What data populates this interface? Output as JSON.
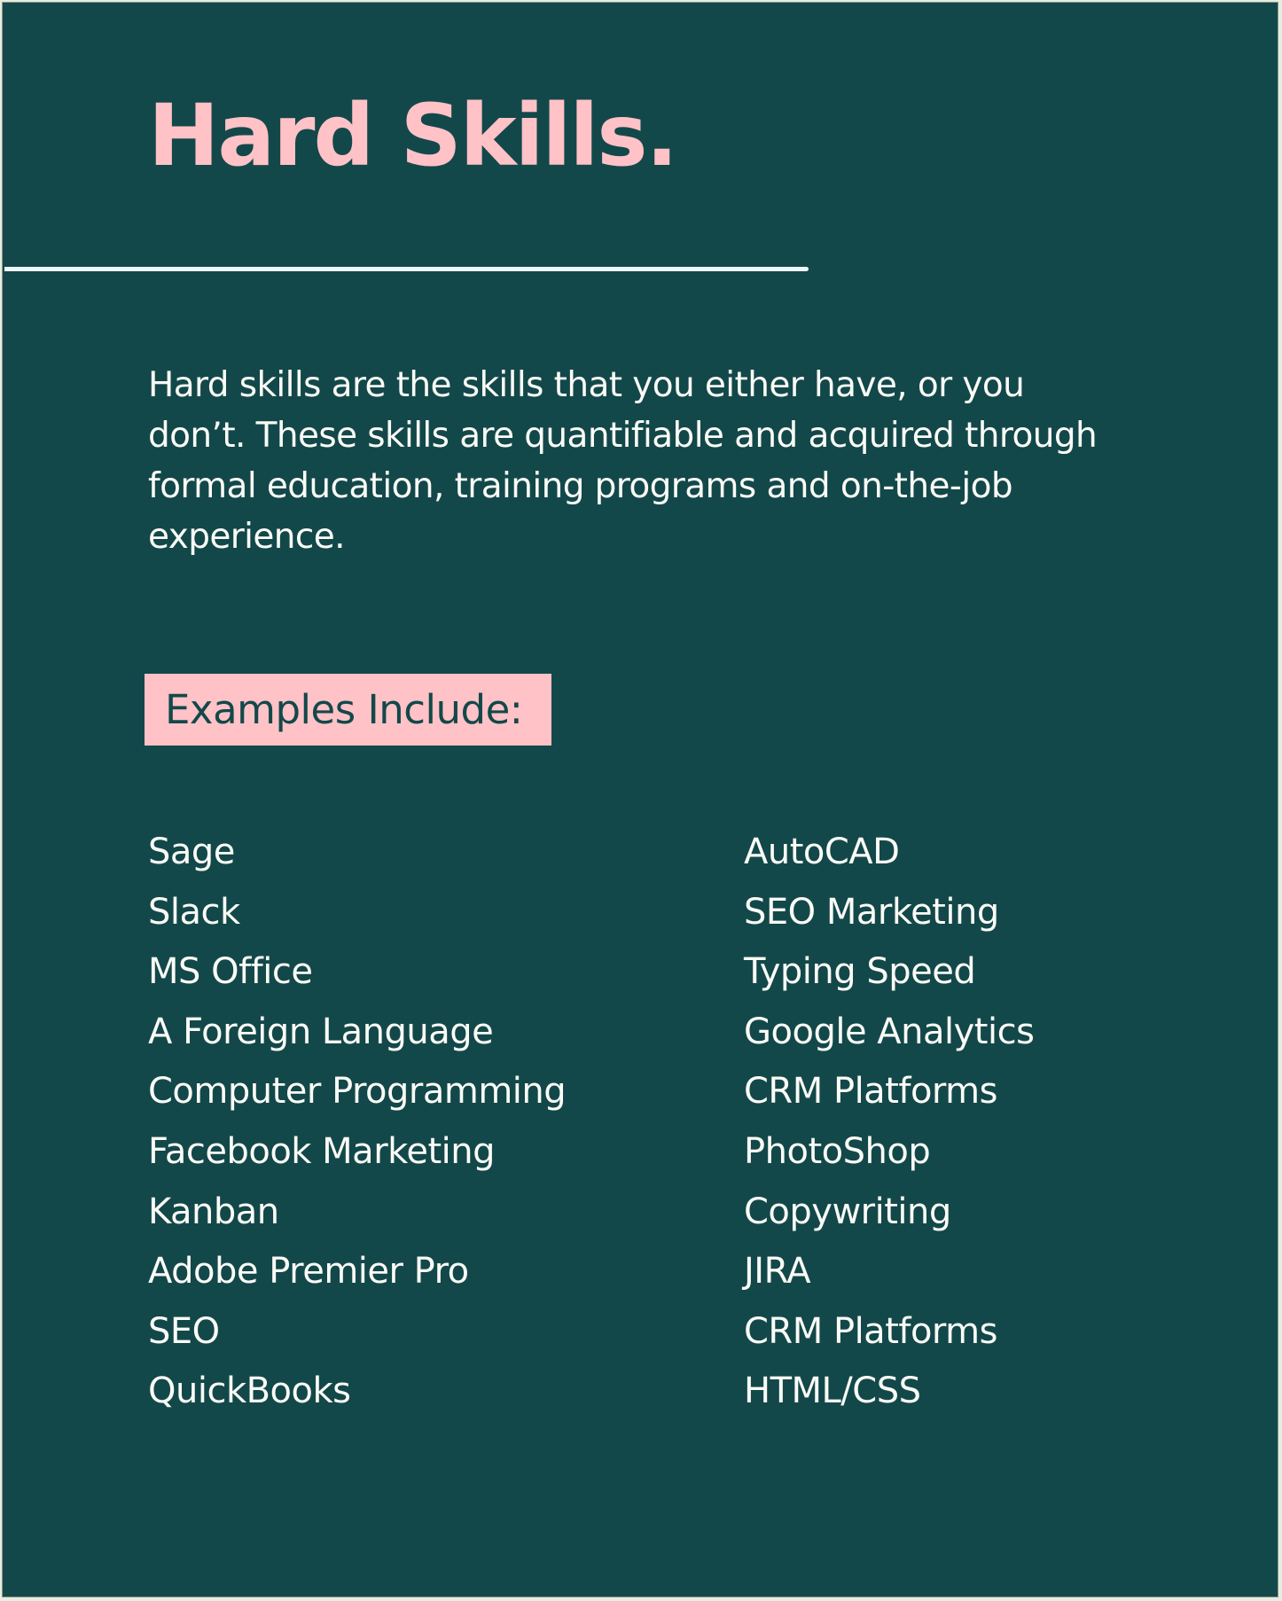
{
  "colors": {
    "background": "#13484a",
    "accent_pink": "#ffc2c7",
    "text_light": "#fbfbf6"
  },
  "title": "Hard Skills.",
  "intro": "Hard skills are the skills that you either have, or you don’t. These skills are quantifiable and acquired through formal education, training programs and on-the-job experience.",
  "examples_label": "Examples Include:",
  "skills_left": [
    "Sage",
    "Slack",
    "MS Office",
    "A Foreign Language",
    "Computer Programming",
    "Facebook Marketing",
    "Kanban",
    "Adobe Premier Pro",
    "SEO",
    "QuickBooks"
  ],
  "skills_right": [
    "AutoCAD",
    "SEO Marketing",
    "Typing Speed",
    "Google Analytics",
    "CRM Platforms",
    "PhotoShop",
    "Copywriting",
    "JIRA",
    "CRM Platforms",
    "HTML/CSS"
  ]
}
